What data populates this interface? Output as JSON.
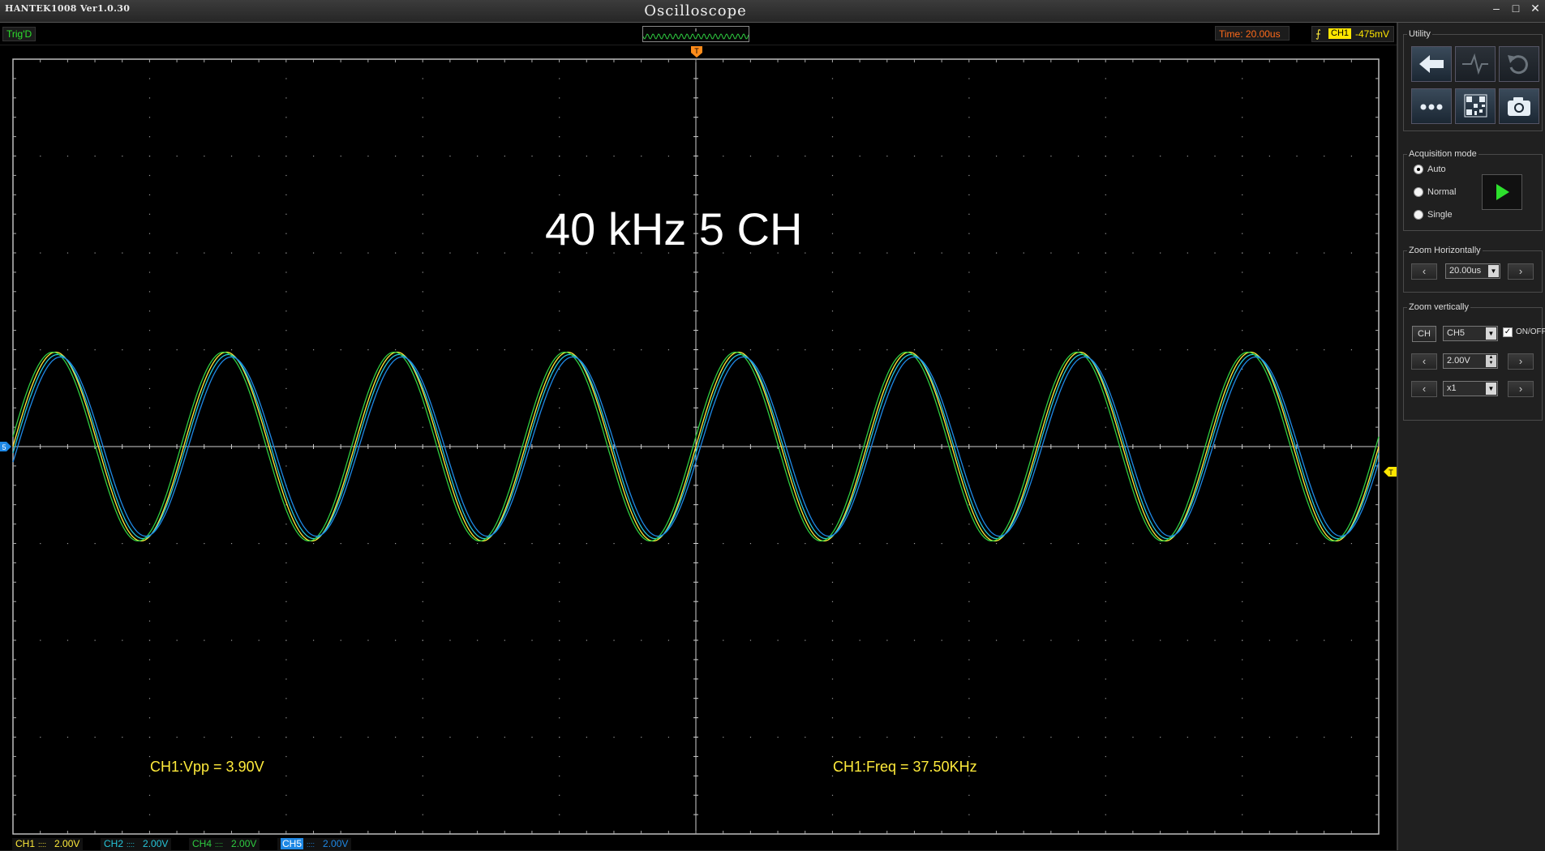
{
  "window": {
    "app_version": "HANTEK1008 Ver1.0.30",
    "title": "Oscilloscope",
    "controls": [
      "–",
      "□",
      "✕"
    ]
  },
  "status": {
    "trigger_state": "Trig'D",
    "time_base": "Time: 20.00us",
    "trigger_channel": "CH1",
    "trigger_level": "-475mV",
    "trigger_edge_icon": "rising-edge-icon"
  },
  "screen": {
    "overlay_title": "40 kHz 5 CH",
    "markers": {
      "trigger_position": "T",
      "trigger_level": "T",
      "channel_ground": "5"
    },
    "measurements": [
      {
        "label": "CH1:Vpp = 3.90V"
      },
      {
        "label": "CH1:Freq = 37.50KHz"
      }
    ],
    "grid": {
      "divisions_x": 10,
      "divisions_y": 8
    },
    "colors": {
      "ch1": "#ffeb3b",
      "ch2": "#26c6da",
      "ch4": "#2ecc40",
      "ch5": "#1e88e5",
      "grid": "#9a9a9a"
    }
  },
  "chart_data": {
    "type": "line",
    "title": "40 kHz 5 CH",
    "xlabel": "",
    "ylabel": "",
    "x_unit": "us",
    "x_per_div": 20,
    "xlim": [
      -100,
      100
    ],
    "y_unit": "V",
    "y_per_div": 2,
    "ylim": [
      -8,
      8
    ],
    "grid": true,
    "series": [
      {
        "name": "CH1",
        "color": "#ffeb3b",
        "frequency_khz": 40,
        "amplitude_v": 1.95,
        "offset_v": 0,
        "phase_deg": 0
      },
      {
        "name": "CH2",
        "color": "#26c6da",
        "frequency_khz": 40,
        "amplitude_v": 1.9,
        "offset_v": 0,
        "phase_deg": -4
      },
      {
        "name": "CH4",
        "color": "#2ecc40",
        "frequency_khz": 40,
        "amplitude_v": 1.95,
        "offset_v": 0,
        "phase_deg": 6
      },
      {
        "name": "CH5",
        "color": "#1e88e5",
        "frequency_khz": 40,
        "amplitude_v": 1.85,
        "offset_v": 0,
        "phase_deg": -10
      }
    ]
  },
  "channels_bar": [
    {
      "name": "CH1",
      "scale": "2.00V",
      "color": "#ffeb3b"
    },
    {
      "name": "CH2",
      "scale": "2.00V",
      "color": "#26c6da"
    },
    {
      "name": "CH4",
      "scale": "2.00V",
      "color": "#2ecc40"
    },
    {
      "name": "CH5",
      "scale": "2.00V",
      "color": "#1e88e5"
    }
  ],
  "panel": {
    "utility": {
      "title": "Utility",
      "buttons": [
        "back-arrow-icon",
        "waveform-icon",
        "undo-icon",
        "more-icon",
        "qr-code-icon",
        "camera-icon"
      ]
    },
    "acquisition": {
      "title": "Acquisition mode",
      "options": [
        "Auto",
        "Normal",
        "Single"
      ],
      "selected": "Auto"
    },
    "zoom_h": {
      "title": "Zoom Horizontally",
      "value": "20.00us"
    },
    "zoom_v": {
      "title": "Zoom vertically",
      "ch_button": "CH",
      "channel": "CH5",
      "onoff_label": "ON/OFF",
      "volts": "2.00V",
      "probe": "x1"
    }
  }
}
